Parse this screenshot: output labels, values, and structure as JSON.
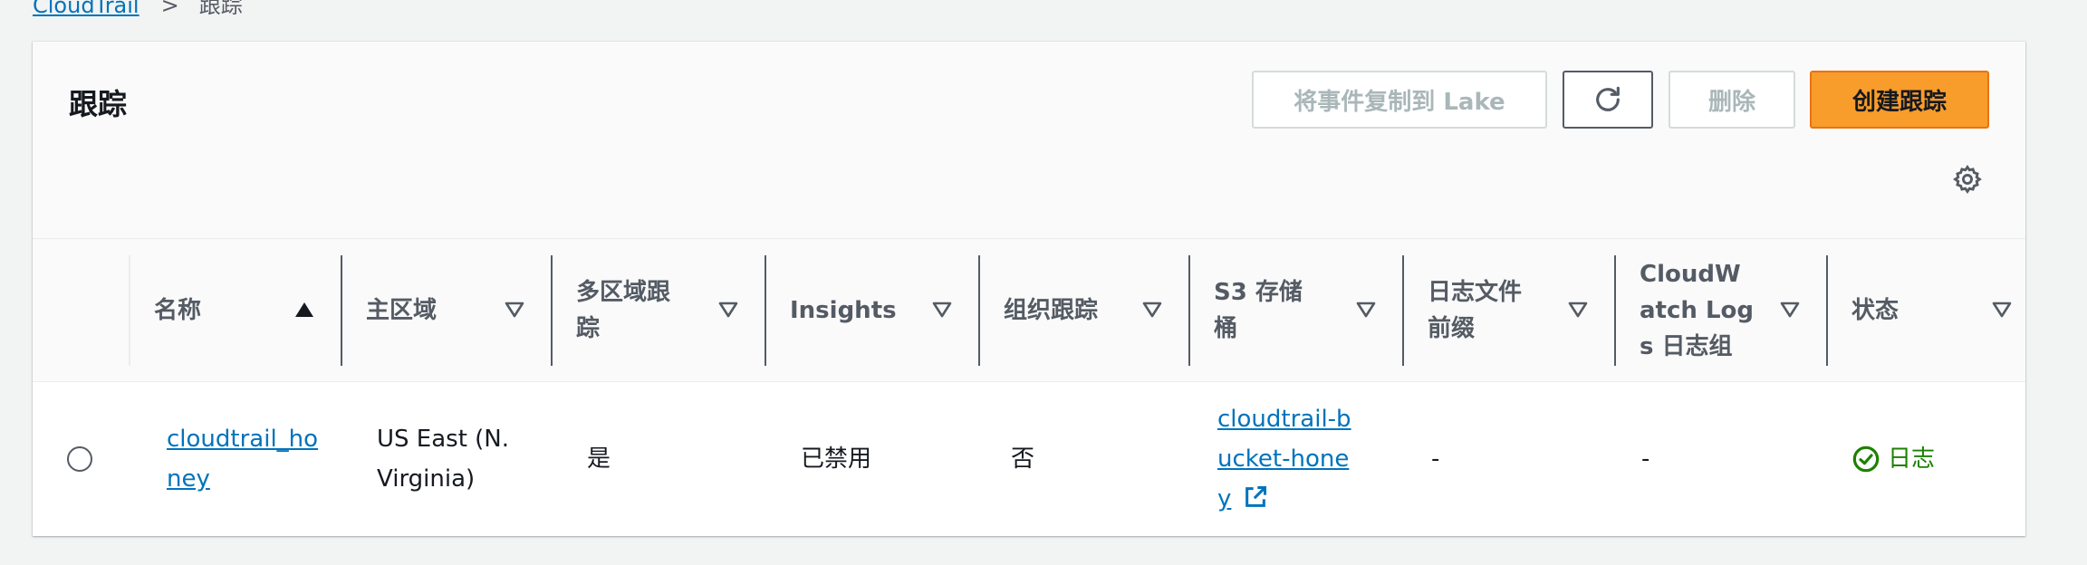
{
  "breadcrumb": {
    "parent": "CloudTrail",
    "separator": ">",
    "current": "跟踪"
  },
  "panel": {
    "title": "跟踪"
  },
  "toolbar": {
    "copy_label": "将事件复制到 Lake",
    "delete_label": "删除",
    "create_label": "创建跟踪",
    "refresh_icon": "refresh-icon",
    "settings_icon": "gear-icon"
  },
  "table": {
    "columns": [
      {
        "label": "名称",
        "sort": "ascending"
      },
      {
        "label": "主区域",
        "sort": "none"
      },
      {
        "label": "多区域跟踪",
        "sort": "none"
      },
      {
        "label": "Insights",
        "sort": "none"
      },
      {
        "label": "组织跟踪",
        "sort": "none"
      },
      {
        "label": "S3 存储桶",
        "sort": "none"
      },
      {
        "label": "日志文件前缀",
        "sort": "none"
      },
      {
        "label": "CloudWatch Logs 日志组",
        "sort": "none"
      },
      {
        "label": "状态",
        "sort": "none"
      }
    ],
    "rows": [
      {
        "name": "cloudtrail_honey",
        "home_region": "US East (N. Virginia)",
        "multi_region": "是",
        "insights": "已禁用",
        "org_trail": "否",
        "s3_bucket": "cloudtrail-bucket-honey",
        "log_prefix": "-",
        "cw_log_group": "-",
        "status": "日志"
      }
    ]
  },
  "colors": {
    "link": "#0073bb",
    "primary_button": "#f89c2c",
    "status_success": "#1d8102",
    "disabled_text": "#aab7b8"
  }
}
